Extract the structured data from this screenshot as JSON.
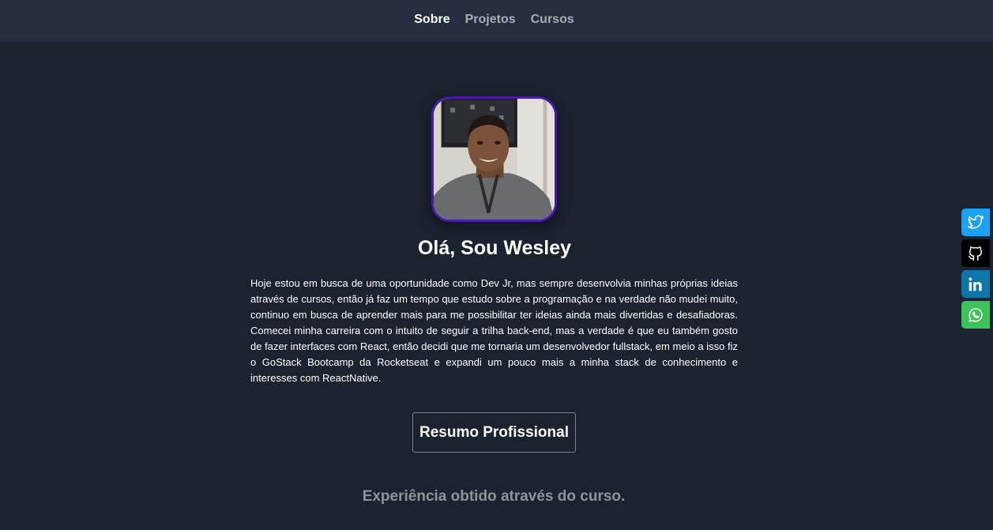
{
  "nav": {
    "items": [
      {
        "label": "Sobre",
        "active": true
      },
      {
        "label": "Projetos",
        "active": false
      },
      {
        "label": "Cursos",
        "active": false
      }
    ]
  },
  "profile": {
    "photo_icon": "profile-photo",
    "greeting": "Olá, Sou Wesley",
    "bio": "Hoje estou em busca de uma oportunidade como Dev Jr, mas sempre desenvolvia minhas próprias ideias através de cursos, então já faz um tempo que estudo sobre a programação e na verdade não mudei muito, continuo em busca de aprender mais para me possibilitar ter ideias ainda mais divertidas e desafiadoras. Comecei minha carreira com o intuito de seguir a trilha back-end, mas a verdade é que eu também gosto de fazer interfaces com React, então decidi que me tornaria um desenvolvedor fullstack, em meio a isso fiz o GoStack Bootcamp da Rocketseat e expandi um pouco mais a minha stack de conhecimento e interesses com ReactNative."
  },
  "resume": {
    "button_label": "Resumo Profissional"
  },
  "experience": {
    "heading": "Experiência obtido através do curso."
  },
  "social": [
    {
      "icon": "twitter-icon",
      "color": "#1da1f2"
    },
    {
      "icon": "github-icon",
      "color": "#000000"
    },
    {
      "icon": "linkedin-icon",
      "color": "#0e76a8"
    },
    {
      "icon": "whatsapp-icon",
      "color": "#25d366"
    }
  ],
  "colors": {
    "background": "#1b2230",
    "header": "#252e3e",
    "avatar_border": "#4a1aa8",
    "muted_text": "#8f949c"
  }
}
